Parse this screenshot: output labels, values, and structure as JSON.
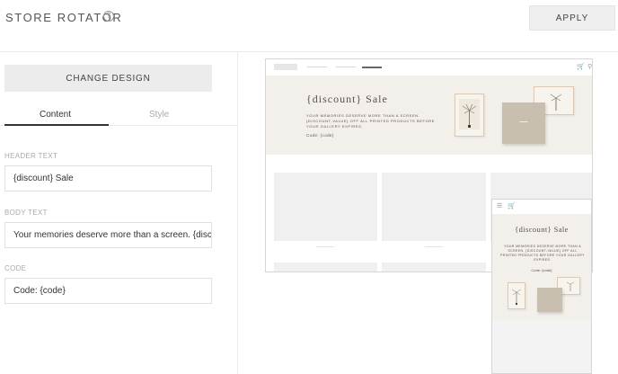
{
  "header": {
    "title": "STORE ROTATOR",
    "help_icon": "?",
    "apply_label": "APPLY"
  },
  "left_panel": {
    "change_design_label": "CHANGE DESIGN",
    "tabs": [
      {
        "label": "Content",
        "active": true
      },
      {
        "label": "Style",
        "active": false
      }
    ],
    "fields": {
      "header_text": {
        "label": "HEADER TEXT",
        "value": "{discount} Sale"
      },
      "body_text": {
        "label": "BODY TEXT",
        "value": "Your memories deserve more than a screen. {discount-value} off all printed products before your gallery expires."
      },
      "code": {
        "label": "CODE",
        "value": "Code: {code}"
      }
    }
  },
  "preview": {
    "desktop": {
      "heading": "{discount} Sale",
      "body": "Your memories deserve more than a screen. {discount-value} off all printed products before your gallery expires.",
      "code": "Code: {code}"
    },
    "mobile": {
      "heading": "{discount} Sale",
      "body": "Your memories deserve more than a screen. {discount-value} off all printed products before your gallery expires.",
      "code": "Code: {code}"
    },
    "colors": {
      "banner_bg": "#f3f0ec",
      "text_brown": "#5a5148",
      "frame_border": "#d9c9b5",
      "book": "#c9bfb1"
    }
  }
}
